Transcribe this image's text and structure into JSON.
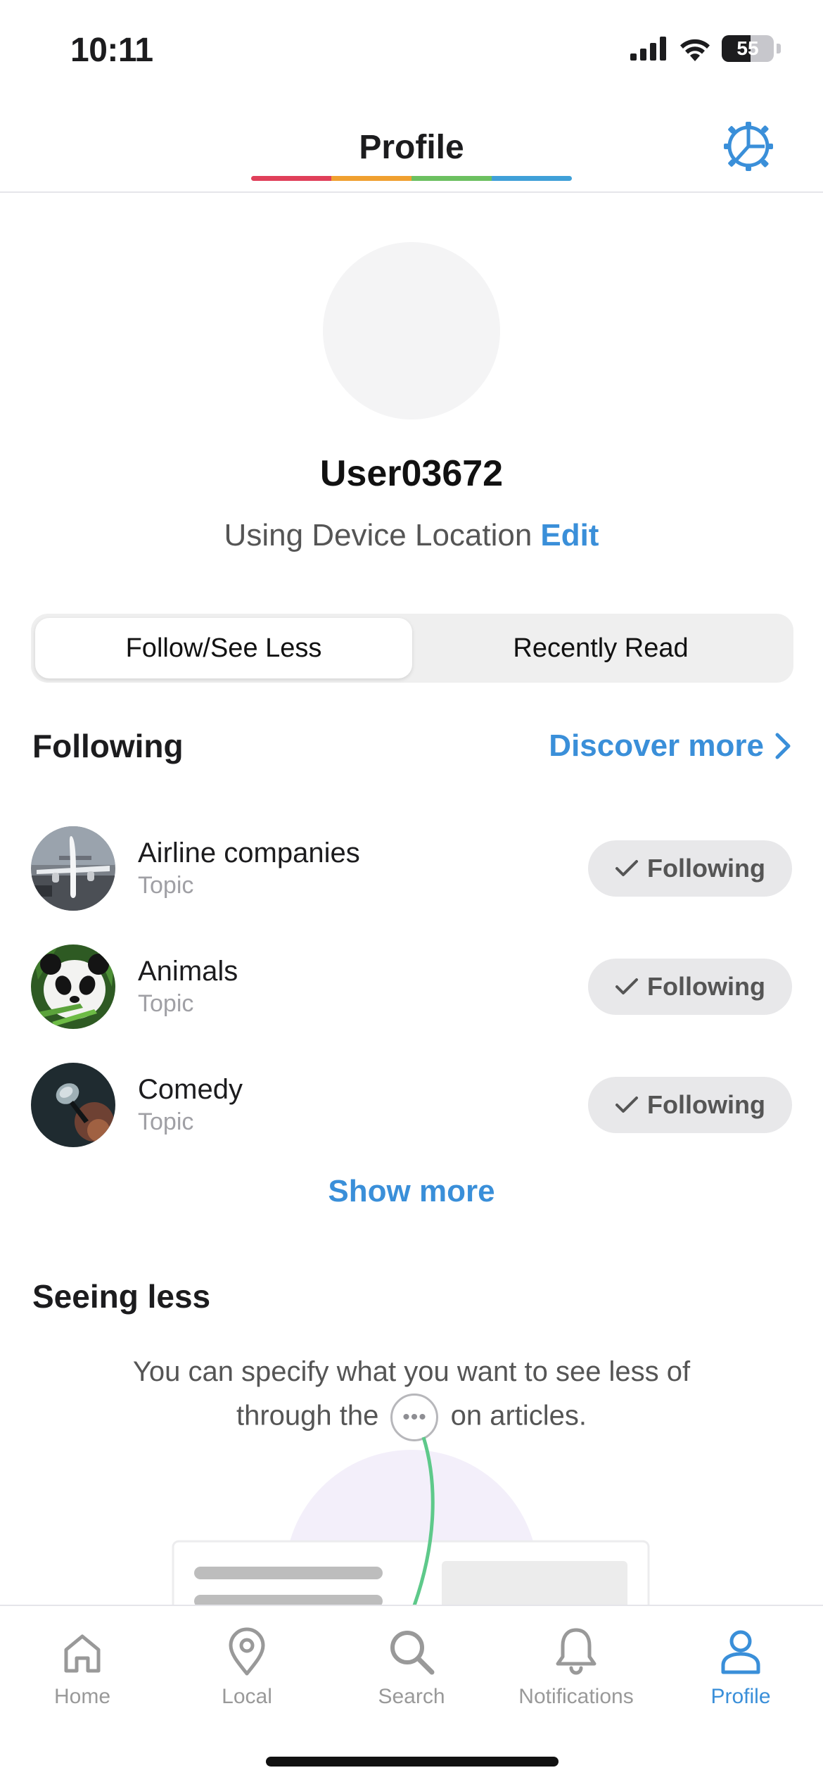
{
  "status_bar": {
    "time": "10:11",
    "battery": "55"
  },
  "header": {
    "title": "Profile"
  },
  "profile": {
    "username": "User03672",
    "location_text": "Using Device Location",
    "edit_label": "Edit"
  },
  "segments": {
    "left": "Follow/See Less",
    "right": "Recently Read"
  },
  "following": {
    "title": "Following",
    "discover_label": "Discover more",
    "items": [
      {
        "name": "Airline companies",
        "type": "Topic",
        "button": "Following"
      },
      {
        "name": "Animals",
        "type": "Topic",
        "button": "Following"
      },
      {
        "name": "Comedy",
        "type": "Topic",
        "button": "Following"
      }
    ],
    "show_more": "Show more"
  },
  "seeing_less": {
    "title": "Seeing less",
    "desc_before": "You can specify what you want to see less of through the",
    "desc_after": "on articles."
  },
  "tabbar": {
    "home": "Home",
    "local": "Local",
    "search": "Search",
    "notifications": "Notifications",
    "profile": "Profile"
  },
  "colors": {
    "accent": "#3a8fd9",
    "following_bg": "#e8e8ea"
  }
}
